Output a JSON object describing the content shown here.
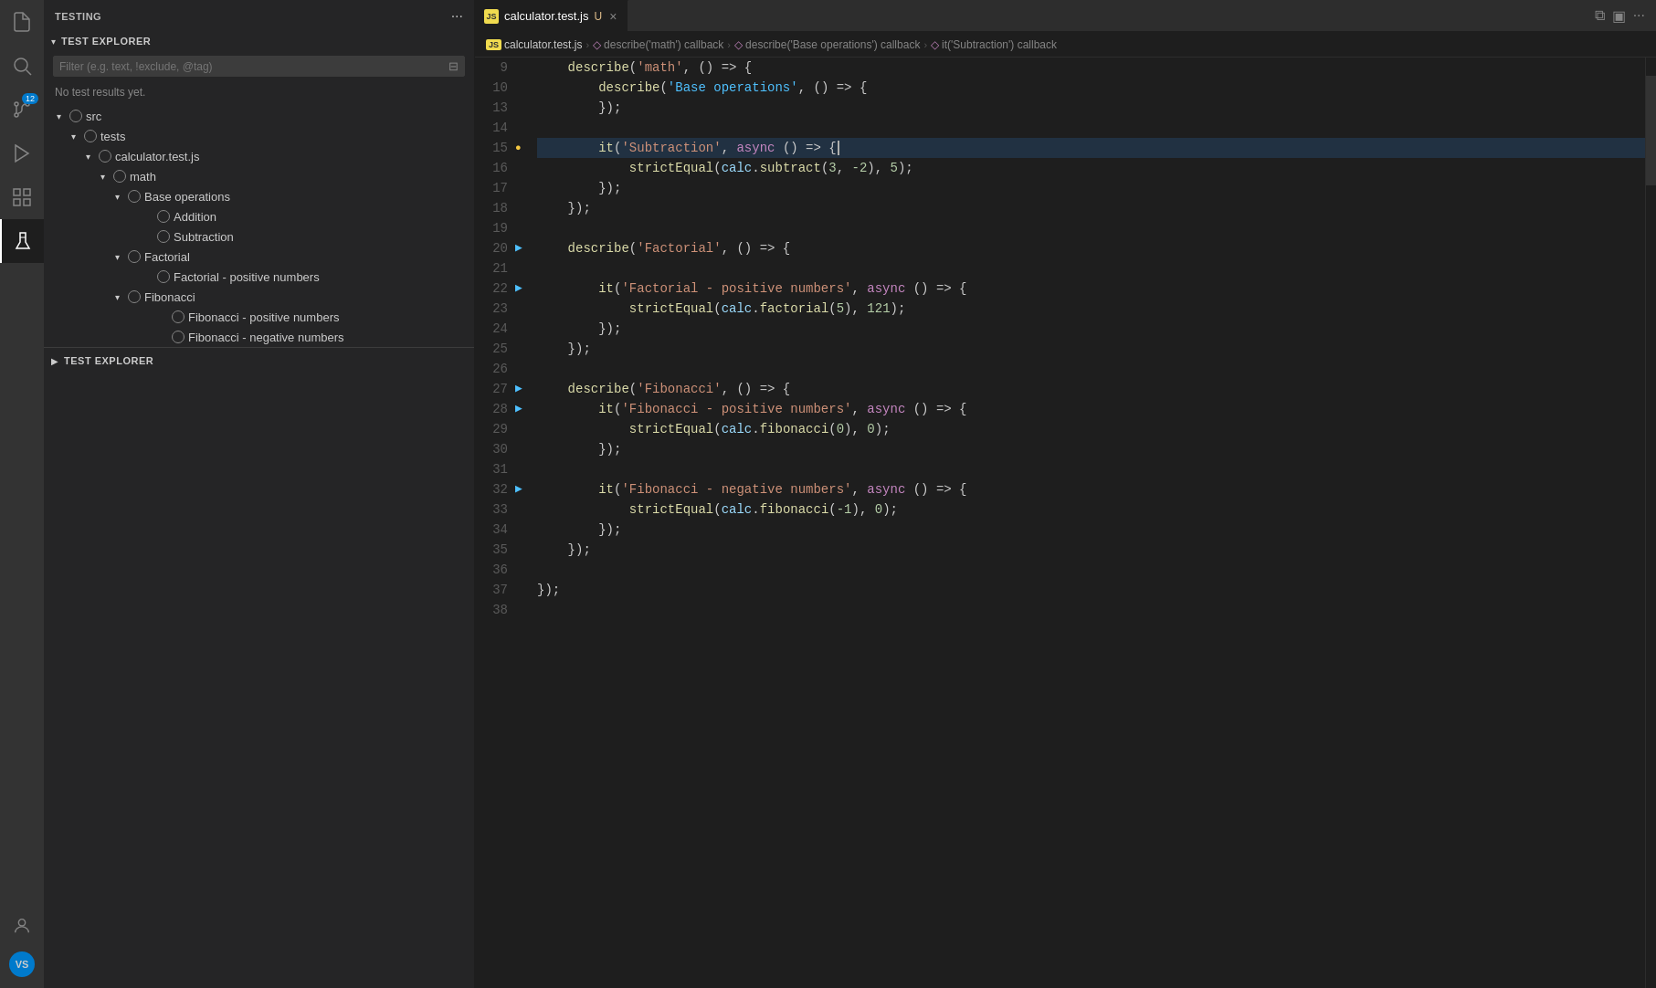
{
  "activityBar": {
    "icons": [
      {
        "name": "files-icon",
        "glyph": "⧉",
        "active": false
      },
      {
        "name": "search-icon",
        "glyph": "🔍",
        "active": false
      },
      {
        "name": "source-control-icon",
        "glyph": "⑂",
        "active": false,
        "badge": "12"
      },
      {
        "name": "run-debug-icon",
        "glyph": "▷",
        "active": false
      },
      {
        "name": "extensions-icon",
        "glyph": "⊞",
        "active": false
      },
      {
        "name": "flask-icon",
        "glyph": "⚗",
        "active": true
      }
    ],
    "bottom": [
      {
        "name": "account-icon",
        "glyph": "👤"
      },
      {
        "name": "settings-icon",
        "glyph": "⚙",
        "label": "VS"
      }
    ]
  },
  "sidebar": {
    "header": {
      "title": "TESTING",
      "moreActions": "···"
    },
    "testExplorer": {
      "label": "TEST EXPLORER",
      "filterPlaceholder": "Filter (e.g. text, !exclude, @tag)",
      "noResults": "No test results yet.",
      "tree": [
        {
          "id": "src",
          "label": "src",
          "indent": 0,
          "hasChevron": true,
          "expanded": true,
          "hasCircle": true
        },
        {
          "id": "tests",
          "label": "tests",
          "indent": 1,
          "hasChevron": true,
          "expanded": true,
          "hasCircle": true
        },
        {
          "id": "calculator-test",
          "label": "calculator.test.js",
          "indent": 2,
          "hasChevron": true,
          "expanded": true,
          "hasCircle": true
        },
        {
          "id": "math",
          "label": "math",
          "indent": 3,
          "hasChevron": true,
          "expanded": true,
          "hasCircle": true
        },
        {
          "id": "base-operations",
          "label": "Base operations",
          "indent": 4,
          "hasChevron": true,
          "expanded": true,
          "hasCircle": true
        },
        {
          "id": "addition",
          "label": "Addition",
          "indent": 5,
          "hasChevron": false,
          "hasCircle": true
        },
        {
          "id": "subtraction",
          "label": "Subtraction",
          "indent": 5,
          "hasChevron": false,
          "hasCircle": true
        },
        {
          "id": "factorial",
          "label": "Factorial",
          "indent": 4,
          "hasChevron": true,
          "expanded": false,
          "hasCircle": true
        },
        {
          "id": "factorial-positive",
          "label": "Factorial - positive numbers",
          "indent": 5,
          "hasChevron": false,
          "hasCircle": true
        },
        {
          "id": "fibonacci",
          "label": "Fibonacci",
          "indent": 4,
          "hasChevron": true,
          "expanded": true,
          "hasCircle": true,
          "hasActions": true
        },
        {
          "id": "fibonacci-positive",
          "label": "Fibonacci - positive numbers",
          "indent": 5,
          "hasChevron": false,
          "hasCircle": true
        },
        {
          "id": "fibonacci-negative",
          "label": "Fibonacci - negative numbers",
          "indent": 5,
          "hasChevron": false,
          "hasCircle": true
        }
      ]
    },
    "bottomSection": {
      "label": "TEST EXPLORER"
    }
  },
  "editor": {
    "tab": {
      "jsIcon": "JS",
      "filename": "calculator.test.js",
      "modified": "U",
      "closeButton": "×"
    },
    "breadcrumb": [
      {
        "label": "calculator.test.js",
        "icon": "js"
      },
      {
        "label": "describe('math') callback",
        "icon": "◇"
      },
      {
        "label": "describe('Base operations') callback",
        "icon": "◇"
      },
      {
        "label": "it('Subtraction') callback",
        "icon": "◇"
      }
    ],
    "lines": [
      {
        "num": 9,
        "content": "describe",
        "type": "describe-line",
        "hasRun": false,
        "text": "    <kw>describe</kw>(<str>'math'</str>, () => {"
      },
      {
        "num": 10,
        "content": "",
        "type": "describe-line",
        "hasRun": false,
        "text": "        <kw>describe</kw>(<str-blue>'Base operations'</str-blue>, () => {"
      },
      {
        "num": 13,
        "content": "",
        "type": "close",
        "hasRun": false,
        "text": "        });"
      },
      {
        "num": 14,
        "content": "",
        "type": "empty",
        "hasRun": false,
        "text": ""
      },
      {
        "num": 15,
        "content": "",
        "type": "it-line",
        "hasRun": true,
        "text": "        <kw>it</kw>(<str>'Subtraction'</str>, <kw>async</kw> () => {",
        "highlighted": true
      },
      {
        "num": 16,
        "content": "",
        "type": "code",
        "hasRun": false,
        "text": "            strictEqual(calc.subtract(3, -2), 5);"
      },
      {
        "num": 17,
        "content": "",
        "type": "close",
        "hasRun": false,
        "text": "        });"
      },
      {
        "num": 18,
        "content": "",
        "type": "close",
        "hasRun": false,
        "text": "    });"
      },
      {
        "num": 19,
        "content": "",
        "type": "empty",
        "hasRun": false,
        "text": ""
      },
      {
        "num": 20,
        "content": "",
        "type": "describe-line",
        "hasRun": true,
        "text": "    <kw>describe</kw>(<str>'Factorial'</str>, () => {"
      },
      {
        "num": 21,
        "content": "",
        "type": "empty",
        "hasRun": false,
        "text": ""
      },
      {
        "num": 22,
        "content": "",
        "type": "it-line",
        "hasRun": true,
        "text": "        <kw>it</kw>(<str>'Factorial - positive numbers'</str>, <kw>async</kw> () => {"
      },
      {
        "num": 23,
        "content": "",
        "type": "code",
        "hasRun": false,
        "text": "            strictEqual(calc.factorial(5), 121);"
      },
      {
        "num": 24,
        "content": "",
        "type": "close",
        "hasRun": false,
        "text": "        });"
      },
      {
        "num": 25,
        "content": "",
        "type": "close",
        "hasRun": false,
        "text": "    });"
      },
      {
        "num": 26,
        "content": "",
        "type": "empty",
        "hasRun": false,
        "text": ""
      },
      {
        "num": 27,
        "content": "",
        "type": "describe-line",
        "hasRun": true,
        "text": "    <kw>describe</kw>(<str>'Fibonacci'</str>, () => {"
      },
      {
        "num": 28,
        "content": "",
        "type": "it-line",
        "hasRun": true,
        "text": "        <kw>it</kw>(<str>'Fibonacci - positive numbers'</str>, <kw>async</kw> () => {"
      },
      {
        "num": 29,
        "content": "",
        "type": "code",
        "hasRun": false,
        "text": "            strictEqual(calc.fibonacci(0), 0);"
      },
      {
        "num": 30,
        "content": "",
        "type": "close",
        "hasRun": false,
        "text": "        });"
      },
      {
        "num": 31,
        "content": "",
        "type": "empty",
        "hasRun": false,
        "text": ""
      },
      {
        "num": 32,
        "content": "",
        "type": "it-line",
        "hasRun": true,
        "text": "        <kw>it</kw>(<str>'Fibonacci - negative numbers'</str>, <kw>async</kw> () => {"
      },
      {
        "num": 33,
        "content": "",
        "type": "code",
        "hasRun": false,
        "text": "            strictEqual(calc.fibonacci(-1), 0);"
      },
      {
        "num": 34,
        "content": "",
        "type": "close",
        "hasRun": false,
        "text": "        });"
      },
      {
        "num": 35,
        "content": "",
        "type": "close",
        "hasRun": false,
        "text": "    });"
      },
      {
        "num": 36,
        "content": "",
        "type": "empty",
        "hasRun": false,
        "text": ""
      },
      {
        "num": 37,
        "content": "",
        "type": "close",
        "hasRun": false,
        "text": "});"
      },
      {
        "num": 38,
        "content": "",
        "type": "empty",
        "hasRun": false,
        "text": ""
      }
    ]
  }
}
